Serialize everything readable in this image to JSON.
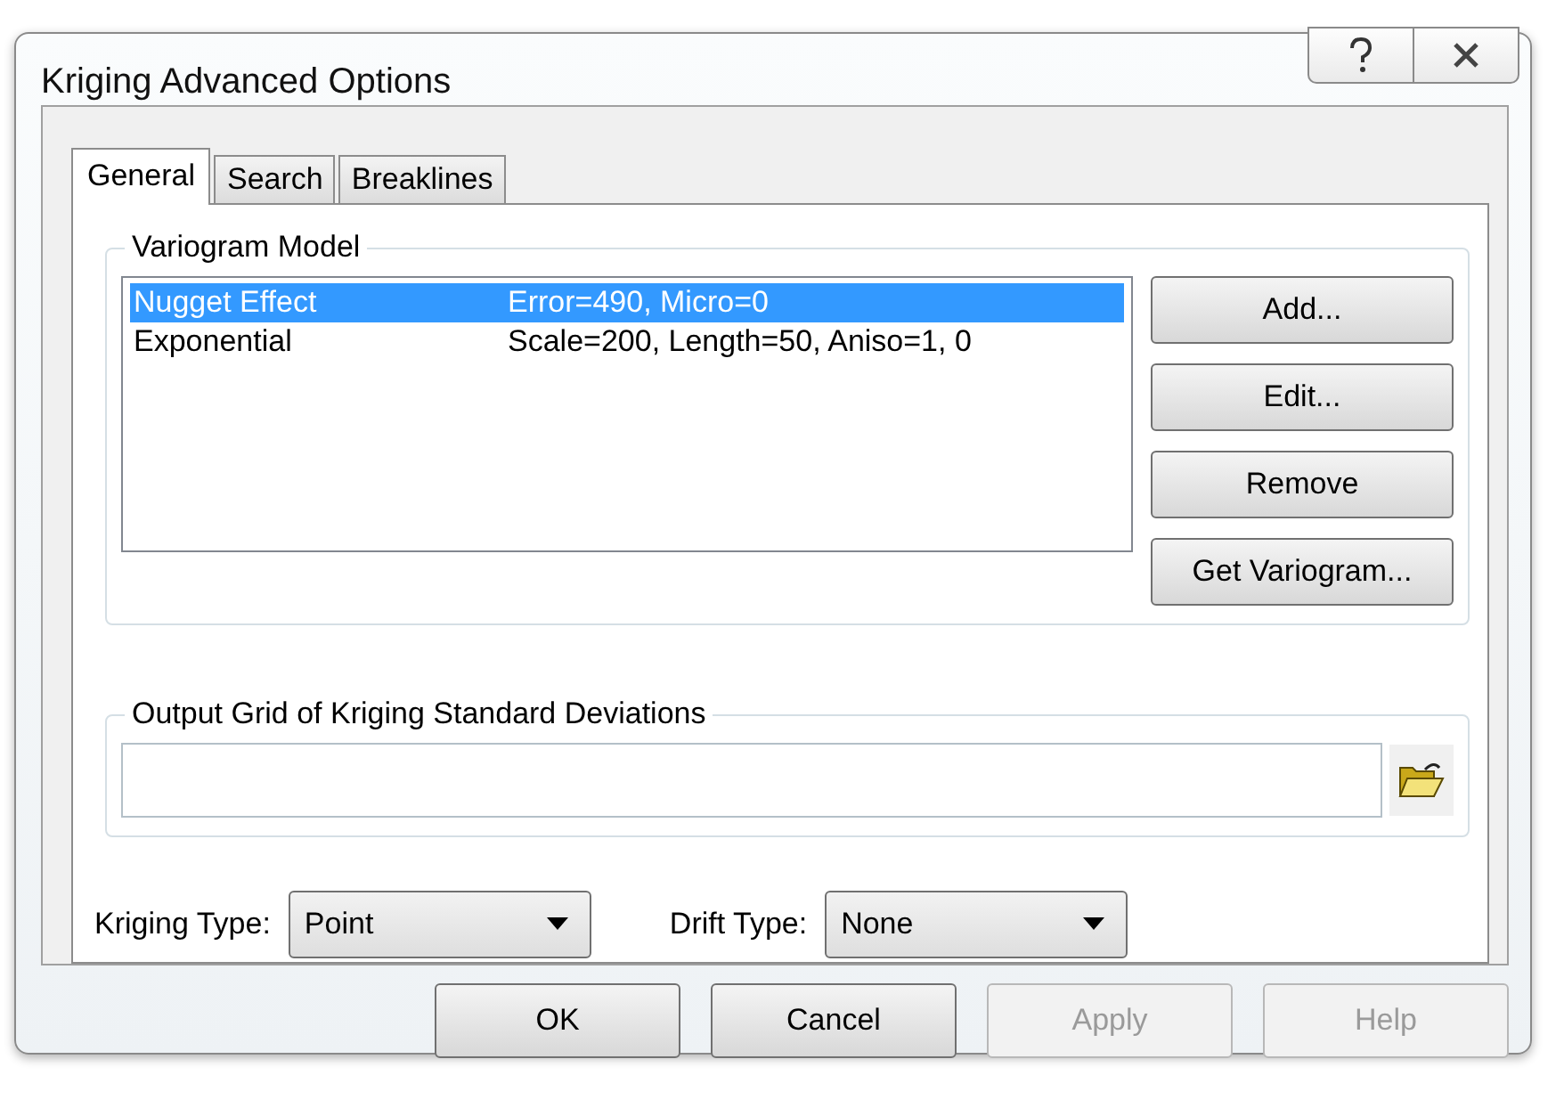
{
  "window": {
    "title": "Kriging Advanced Options"
  },
  "tabs": [
    {
      "label": "General",
      "selected": true
    },
    {
      "label": "Search",
      "selected": false
    },
    {
      "label": "Breaklines",
      "selected": false
    }
  ],
  "variogram_model": {
    "title": "Variogram Model",
    "rows": [
      {
        "name": "Nugget Effect",
        "params": "Error=490, Micro=0",
        "selected": true
      },
      {
        "name": "Exponential",
        "params": "Scale=200, Length=50, Aniso=1, 0",
        "selected": false
      }
    ],
    "buttons": [
      "Add...",
      "Edit...",
      "Remove",
      "Get Variogram..."
    ]
  },
  "output_grid": {
    "title": "Output Grid of Kriging Standard Deviations"
  },
  "kriging_type": {
    "label": "Kriging Type:",
    "value": "Point"
  },
  "drift_type": {
    "label": "Drift Type:",
    "value": "None"
  },
  "buttons": [
    {
      "label": "OK",
      "disabled": false
    },
    {
      "label": "Cancel",
      "disabled": false
    },
    {
      "label": "Apply",
      "disabled": true
    },
    {
      "label": "Help",
      "disabled": true
    }
  ]
}
